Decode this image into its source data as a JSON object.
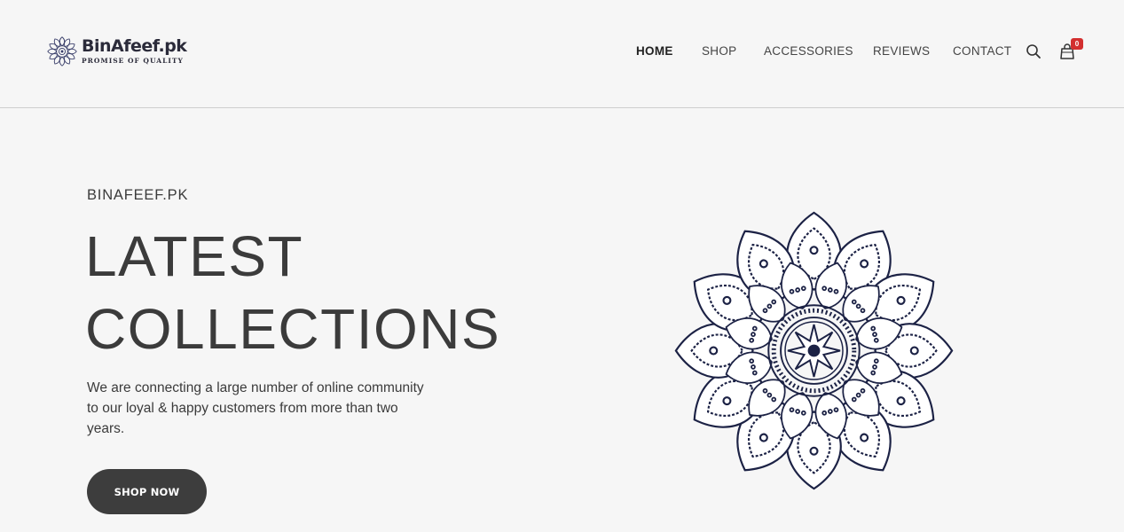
{
  "header": {
    "logo_title": "BinAfeef.pk",
    "logo_subtitle": "PROMISE OF QUALITY",
    "nav": [
      {
        "label": "HOME",
        "active": true
      },
      {
        "label": "SHOP",
        "active": false
      },
      {
        "label": "ACCESSORIES",
        "active": false
      },
      {
        "label": "REVIEWS",
        "active": false
      },
      {
        "label": "CONTACT",
        "active": false
      }
    ],
    "search_icon": "search-icon",
    "cart_icon": "shopping-bag-icon",
    "cart_count": "0"
  },
  "hero": {
    "eyebrow": "BINAFEEF.PK",
    "headline_line1": "LATEST",
    "headline_line2": "COLLECTIONS",
    "description": "We are connecting a large number of online community to our loyal & happy customers from more than two years.",
    "cta_label": "SHOP NOW",
    "image_icon": "mandala-illustration"
  },
  "colors": {
    "background": "#f6f6f6",
    "text": "#3b3b3b",
    "button": "#3d3d3d",
    "badge": "#d32f2f",
    "mandala": "#1c2245"
  }
}
